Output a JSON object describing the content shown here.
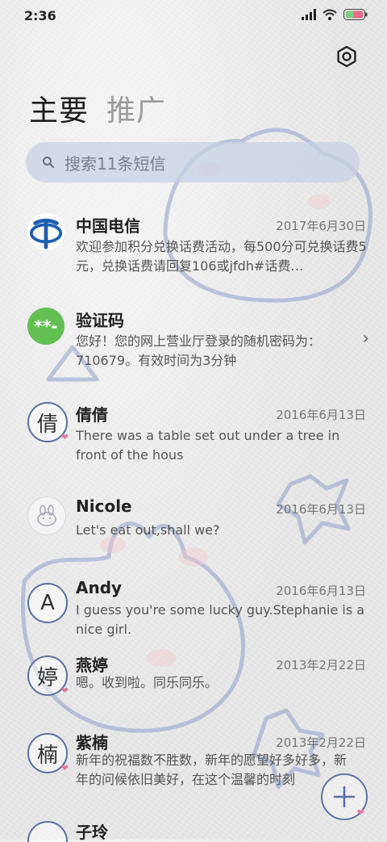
{
  "status_bar": {
    "time": "2:36"
  },
  "tabs": [
    {
      "label": "主要"
    },
    {
      "label": "推广"
    }
  ],
  "search": {
    "placeholder": "搜索11条短信"
  },
  "conversations": [
    {
      "name": "中国电信",
      "date": "2017年6月30日",
      "preview": "欢迎参加积分兑换话费活动，每500分可兑换话费5元，兑换话费请回复106或jfdh#话费…",
      "avatar_icon": "china-telecom-logo-icon"
    },
    {
      "name": "验证码",
      "date": "",
      "preview": "您好！您的网上营业厅登录的随机密码为：710679。有效时间为3分钟",
      "avatar_text": "**-",
      "avatar_color": "#62c053"
    },
    {
      "name": "倩倩",
      "date": "2016年6月13日",
      "preview": "There was a table set out under a tree in front of the hous",
      "avatar_text": "倩"
    },
    {
      "name": "Nicole",
      "date": "2016年6月13日",
      "preview": "Let's eat out,shall we?",
      "avatar_icon": "bunny-avatar-icon"
    },
    {
      "name": "Andy",
      "date": "2016年6月13日",
      "preview": "I guess you're some lucky guy.Stephanie is a nice girl.",
      "avatar_text": "A"
    },
    {
      "name": "燕婷",
      "date": "2013年2月22日",
      "preview": "嗯。收到啦。同乐同乐。",
      "avatar_text": "婷"
    },
    {
      "name": "紫楠",
      "date": "2013年2月22日",
      "preview": "新年的祝福数不胜数，新年的愿望好多好多，新年的问候依旧美好，在这个温馨的时刻",
      "avatar_text": "楠"
    },
    {
      "name": "子玲",
      "date": "",
      "preview": "",
      "avatar_text": ""
    }
  ],
  "colors": {
    "accent_outline": "#5a6fa2",
    "battery": "#e86c8b",
    "verify_avatar": "#62c053"
  }
}
